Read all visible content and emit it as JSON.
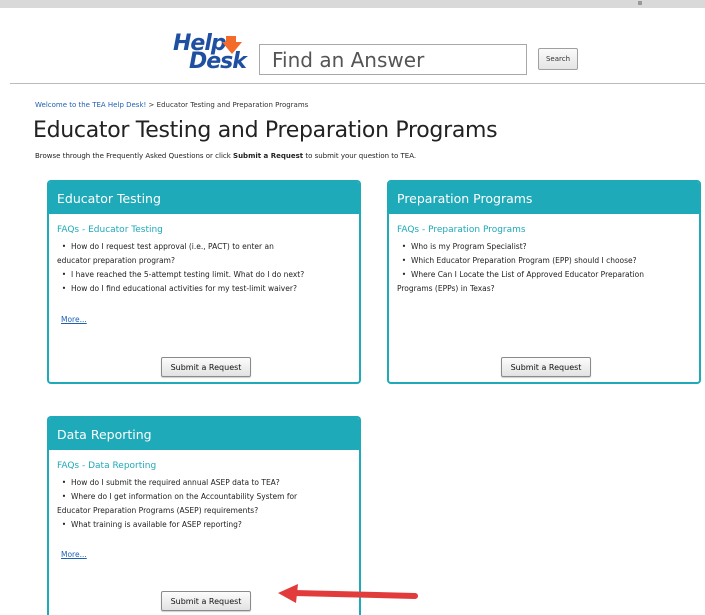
{
  "header": {
    "logo_help": "Help",
    "logo_desk": "Desk",
    "search_placeholder": "Find an Answer",
    "search_button": "Search"
  },
  "breadcrumb": {
    "home": "Welcome to the TEA Help Desk!",
    "separator": ">",
    "current": "Educator Testing and Preparation Programs"
  },
  "page": {
    "title": "Educator Testing and Preparation Programs",
    "intro_before": "Browse through the Frequently Asked Questions or click ",
    "intro_bold": "Submit a Request",
    "intro_after": " to submit your question to TEA."
  },
  "cards": [
    {
      "title": "Educator Testing",
      "faq_title": "FAQs - Educator Testing",
      "items": [
        "How do I request test approval (i.e., PACT) to enter an",
        "educator preparation program?",
        "I have reached the 5-attempt testing limit. What do I do next?",
        "How do I find educational activities for my test-limit waiver?"
      ],
      "more": "More...",
      "button": "Submit a Request"
    },
    {
      "title": "Preparation Programs",
      "faq_title": "FAQs - Preparation Programs",
      "items": [
        "Who is my Program Specialist?",
        "Which Educator Preparation Program (EPP) should I choose?",
        "Where Can I Locate the List of Approved Educator Preparation",
        "Programs (EPPs) in Texas?"
      ],
      "button": "Submit a Request"
    },
    {
      "title": "Data Reporting",
      "faq_title": "FAQs - Data Reporting",
      "items": [
        "How do I submit the required annual ASEP data to TEA?",
        "Where do I get information on the Accountability System for",
        "Educator Preparation Programs (ASEP) requirements?",
        "What training is available for ASEP reporting?"
      ],
      "more": "More...",
      "button": "Submit a Request"
    }
  ],
  "colors": {
    "accent": "#1eaab9",
    "link": "#1f5fb5",
    "logo_blue": "#1f4fa0",
    "logo_orange": "#f26b2a",
    "annotation_arrow": "#e23b3b"
  }
}
